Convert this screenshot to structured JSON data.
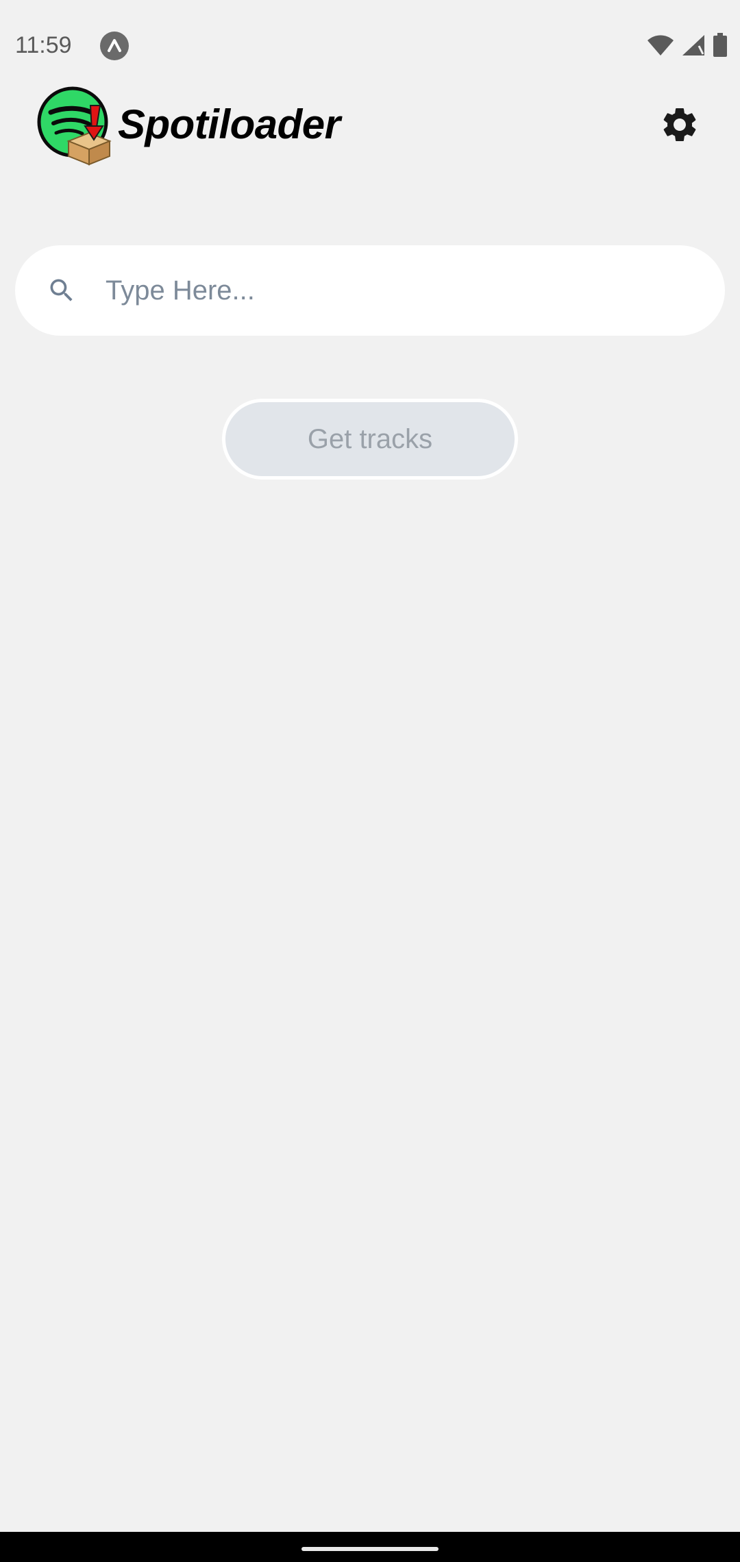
{
  "status_bar": {
    "time": "11:59",
    "app_badge_icon": "app-notification-icon",
    "wifi_icon": "wifi-icon",
    "signal_icon": "cell-signal-icon",
    "battery_icon": "battery-icon"
  },
  "header": {
    "title": "Spotiloader",
    "logo_icon": "spotiloader-logo-icon",
    "settings_icon": "gear-icon"
  },
  "search": {
    "placeholder": "Type Here...",
    "value": "",
    "icon": "search-icon"
  },
  "actions": {
    "get_tracks_label": "Get tracks"
  },
  "colors": {
    "background": "#f1f1f1",
    "search_background": "#ffffff",
    "placeholder": "#7d8a99",
    "button_background": "#e1e5ea",
    "button_text": "#9aa1a9",
    "logo_green": "#2fd866",
    "accent_red": "#e01414"
  }
}
